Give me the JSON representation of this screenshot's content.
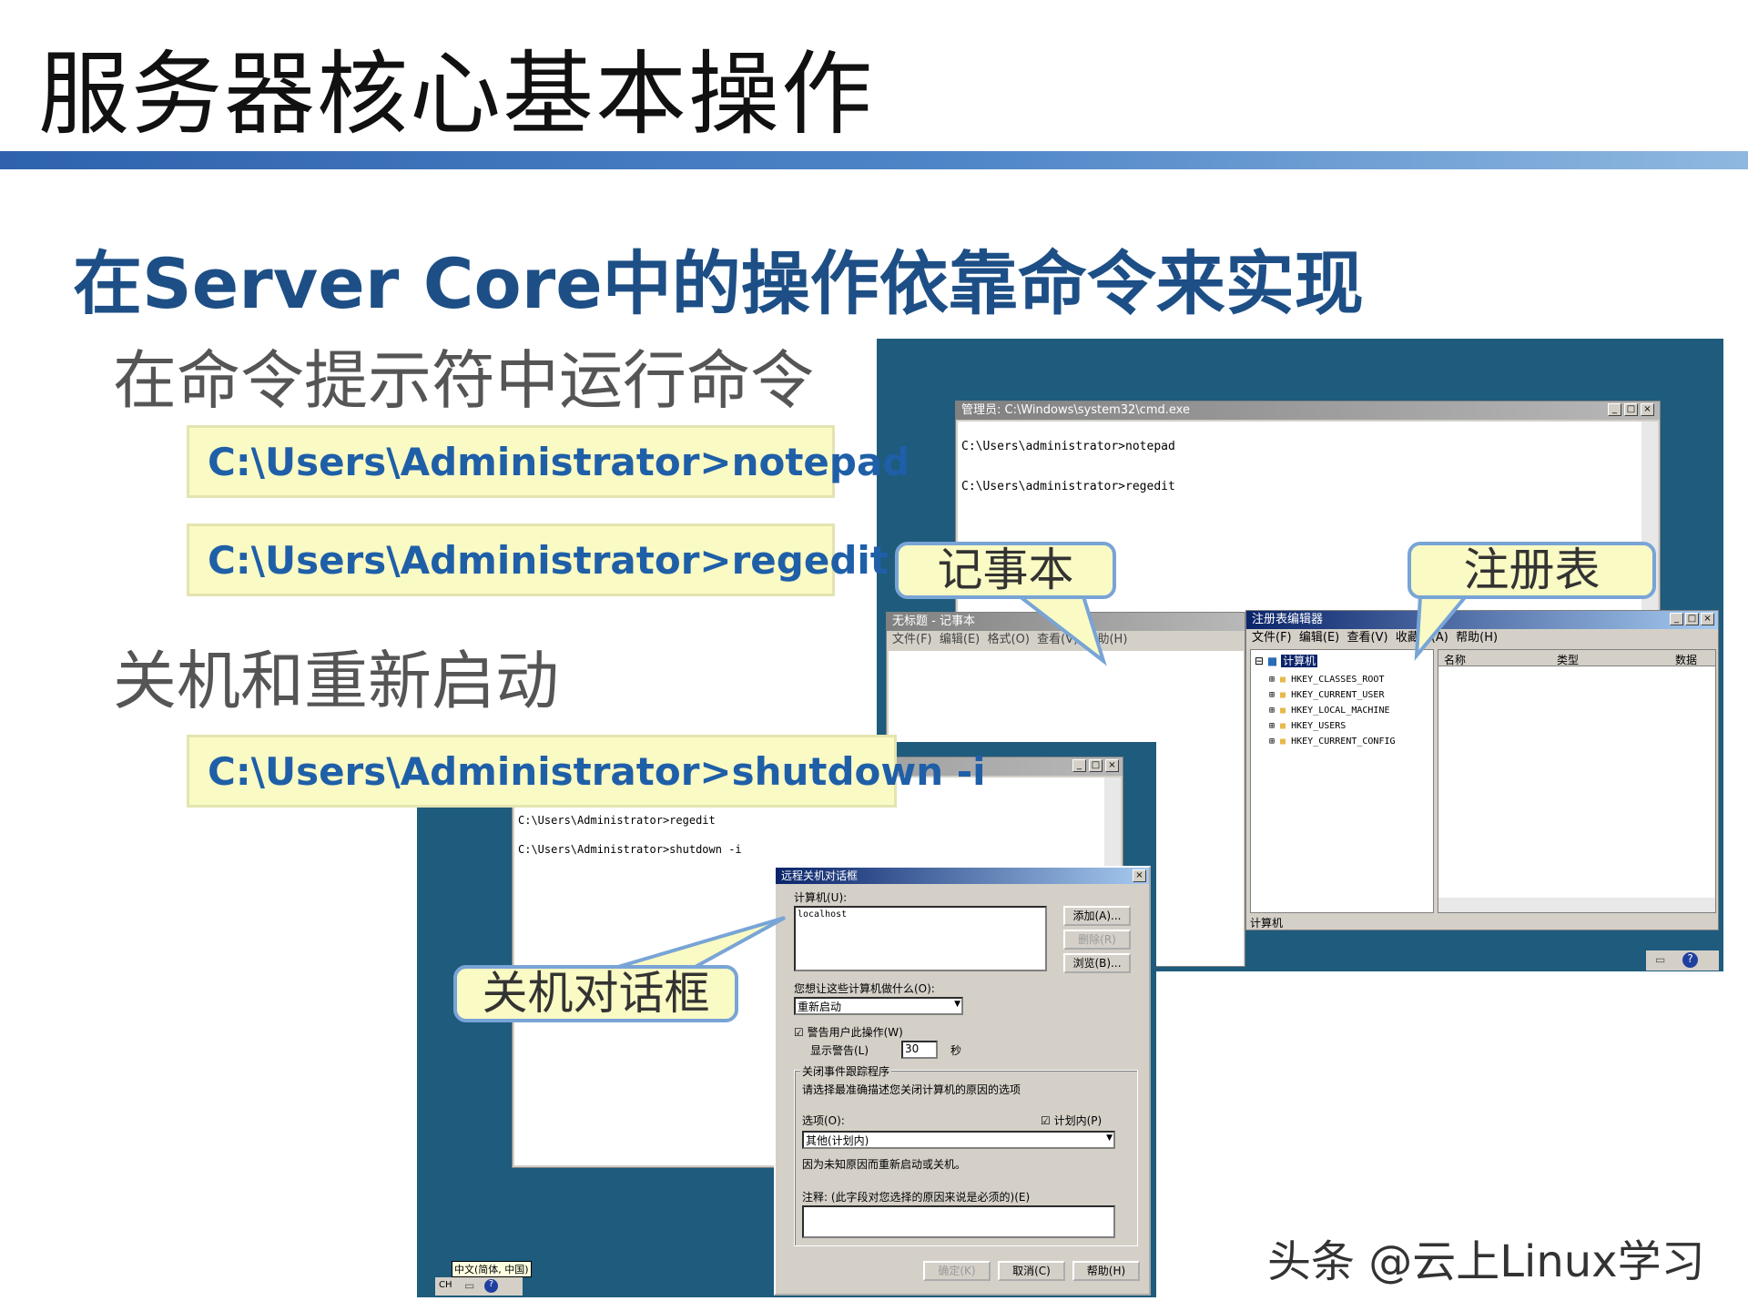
{
  "slide": {
    "title": "服务器核心基本操作",
    "subtitle": "在Server Core中的操作依靠命令来实现",
    "section1": "在命令提示符中运行命令",
    "section2": "关机和重新启动",
    "cmd_notepad": "C:\\Users\\Administrator>notepad",
    "cmd_regedit": "C:\\Users\\Administrator>regedit",
    "cmd_shutdown": "C:\\Users\\Administrator>shutdown -i",
    "callout_notepad": "记事本",
    "callout_regedit": "注册表",
    "callout_shutdown": "关机对话框",
    "watermark": "头条 @云上Linux学习"
  },
  "cmd_window": {
    "title": "管理员: C:\\Windows\\system32\\cmd.exe",
    "line1": "C:\\Users\\administrator>notepad",
    "line2": "C:\\Users\\administrator>regedit",
    "btn_min": "_",
    "btn_max": "□",
    "btn_close": "×"
  },
  "notepad": {
    "title": "无标题 - 记事本",
    "menu": [
      "文件(F)",
      "编辑(E)",
      "格式(O)",
      "查看(V)",
      "帮助(H)"
    ]
  },
  "regedit": {
    "title": "注册表编辑器",
    "menu": [
      "文件(F)",
      "编辑(E)",
      "查看(V)",
      "收藏夹(A)",
      "帮助(H)"
    ],
    "root": "计算机",
    "keys": [
      "HKEY_CLASSES_ROOT",
      "HKEY_CURRENT_USER",
      "HKEY_LOCAL_MACHINE",
      "HKEY_USERS",
      "HKEY_CURRENT_CONFIG"
    ],
    "columns": [
      "名称",
      "类型",
      "数据"
    ],
    "status": "计算机"
  },
  "cmd2": {
    "line1": "C:\\Users\\Administrator>regedit",
    "line2": "C:\\Users\\Administrator>shutdown -i"
  },
  "shutdown_dialog": {
    "title": "远程关机对话框",
    "computers_label": "计算机(U):",
    "computer_value": "localhost",
    "add": "添加(A)...",
    "remove": "删除(R)",
    "browse": "浏览(B)...",
    "action_label": "您想让这些计算机做什么(O):",
    "action_value": "重新启动",
    "warn_label": "警告用户此操作(W)",
    "display_label": "显示警告(L)",
    "seconds_value": "30",
    "seconds_unit": "秒",
    "tracker_label": "关闭事件跟踪程序",
    "tracker_desc": "请选择最准确描述您关闭计算机的原因的选项",
    "option_label": "选项(O):",
    "planned_label": "计划内(P)",
    "option_value": "其他(计划内)",
    "reason_text": "因为未知原因而重新启动或关机。",
    "comment_label": "注释: (此字段对您选择的原因来说是必须的)(E)",
    "ok": "确定(K)",
    "cancel": "取消(C)",
    "help": "帮助(H)"
  },
  "taskbar": {
    "lang_tip": "中文(简体, 中国)",
    "lang_code": "CH"
  }
}
